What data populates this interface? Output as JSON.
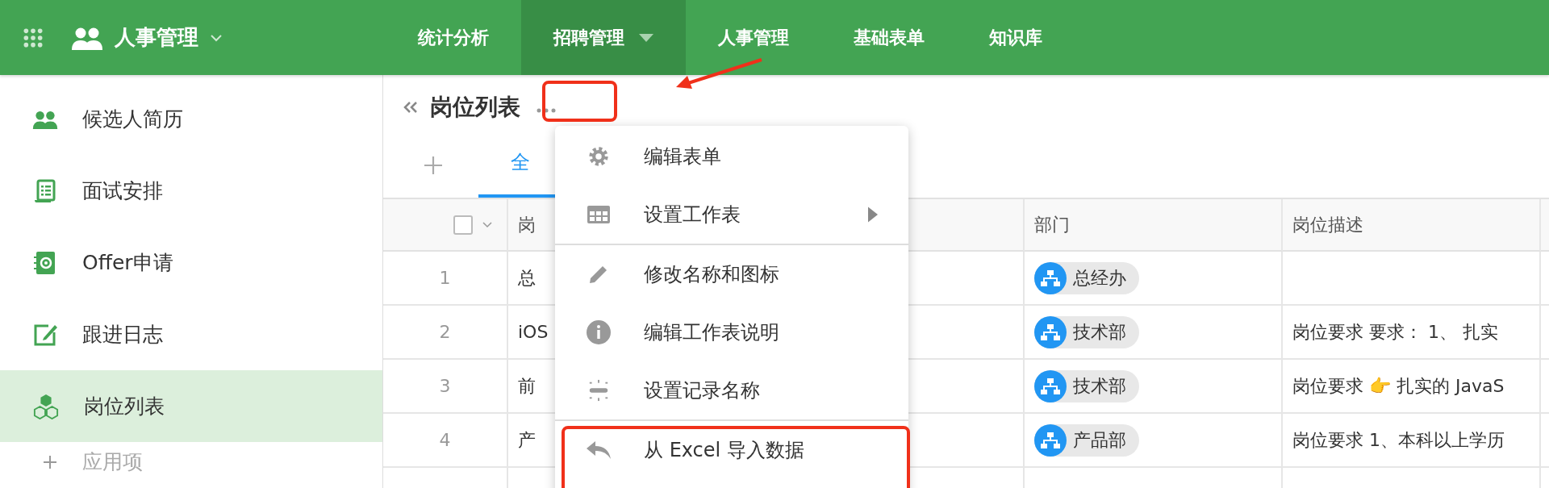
{
  "app": {
    "title": "人事管理"
  },
  "nav": [
    {
      "label": "统计分析",
      "selected": false,
      "has_menu": false
    },
    {
      "label": "招聘管理",
      "selected": true,
      "has_menu": true
    },
    {
      "label": "人事管理",
      "selected": false,
      "has_menu": false
    },
    {
      "label": "基础表单",
      "selected": false,
      "has_menu": false
    },
    {
      "label": "知识库",
      "selected": false,
      "has_menu": false
    }
  ],
  "sidebar": {
    "items": [
      {
        "label": "候选人简历",
        "selected": false
      },
      {
        "label": "面试安排",
        "selected": false
      },
      {
        "label": "Offer申请",
        "selected": false
      },
      {
        "label": "跟进日志",
        "selected": false
      },
      {
        "label": "岗位列表",
        "selected": true
      }
    ],
    "add_label": "应用项"
  },
  "page": {
    "title": "岗位列表",
    "more_annotated": true
  },
  "view_tabs": [
    {
      "label": "全",
      "selected": true
    }
  ],
  "table": {
    "select_all_checked": false,
    "columns": [
      "岗",
      "部门",
      "岗位描述"
    ],
    "rows": [
      {
        "number": "1",
        "position": "总",
        "department": "总经办"
      },
      {
        "number": "2",
        "position": "iOS",
        "department": "技术部",
        "description": "岗位要求 要求： 1、 扎实"
      },
      {
        "number": "3",
        "position": "前",
        "department": "技术部",
        "description": "岗位要求 👉 扎实的 JavaS"
      },
      {
        "number": "4",
        "position": "产",
        "department": "产品部",
        "description": "岗位要求 1、本科以上学历"
      }
    ]
  },
  "menu": {
    "items": [
      {
        "label": "编辑表单",
        "has_submenu": false,
        "divider_before": false,
        "annotated": false
      },
      {
        "label": "设置工作表",
        "has_submenu": true,
        "divider_before": false,
        "annotated": false
      },
      {
        "label": "修改名称和图标",
        "has_submenu": false,
        "divider_before": true,
        "annotated": false
      },
      {
        "label": "编辑工作表说明",
        "has_submenu": false,
        "divider_before": false,
        "annotated": false
      },
      {
        "label": "设置记录名称",
        "has_submenu": false,
        "divider_before": false,
        "annotated": false
      },
      {
        "label": "从 Excel 导入数据",
        "has_submenu": false,
        "divider_before": true,
        "annotated": true
      }
    ]
  }
}
